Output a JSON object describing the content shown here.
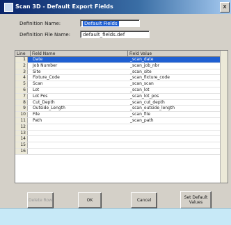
{
  "window": {
    "title": "Scan 3D - Default Export Fields",
    "close_label": "x"
  },
  "form": {
    "definition_name_label": "Definition Name:",
    "definition_name_value": "Default Fields",
    "definition_file_label": "Definition File Name:",
    "definition_file_value": "default_fields.def"
  },
  "grid": {
    "columns": [
      "Line",
      "Field Name",
      "Field Value"
    ],
    "rows": [
      {
        "num": "1",
        "name": "Date",
        "value": "_scan_date"
      },
      {
        "num": "2",
        "name": "Job Number",
        "value": "_scan_job_nbr"
      },
      {
        "num": "3",
        "name": "Site",
        "value": "_scan_site"
      },
      {
        "num": "4",
        "name": "Fixture_Code",
        "value": "_scan_fixture_code"
      },
      {
        "num": "5",
        "name": "Scan",
        "value": "_scan_scan"
      },
      {
        "num": "6",
        "name": "Lot",
        "value": "_scan_lot"
      },
      {
        "num": "7",
        "name": "Lot Pos",
        "value": "_scan_lot_pos"
      },
      {
        "num": "8",
        "name": "Cut_Depth",
        "value": "_scan_cut_depth"
      },
      {
        "num": "9",
        "name": "Outside_Length",
        "value": "_scan_outside_length"
      },
      {
        "num": "10",
        "name": "File",
        "value": "_scan_file"
      },
      {
        "num": "11",
        "name": "Path",
        "value": "_scan_path"
      },
      {
        "num": "12",
        "name": "",
        "value": ""
      },
      {
        "num": "13",
        "name": "",
        "value": ""
      },
      {
        "num": "14",
        "name": "",
        "value": ""
      },
      {
        "num": "15",
        "name": "",
        "value": ""
      },
      {
        "num": "16",
        "name": "",
        "value": ""
      }
    ]
  },
  "buttons": {
    "delete_row": "Delete Row",
    "ok": "OK",
    "cancel": "Cancel",
    "set_defaults": "Set Default Values"
  },
  "colors": {
    "selection": "#1e5fd2",
    "statusbar": "#c7e9f7"
  }
}
